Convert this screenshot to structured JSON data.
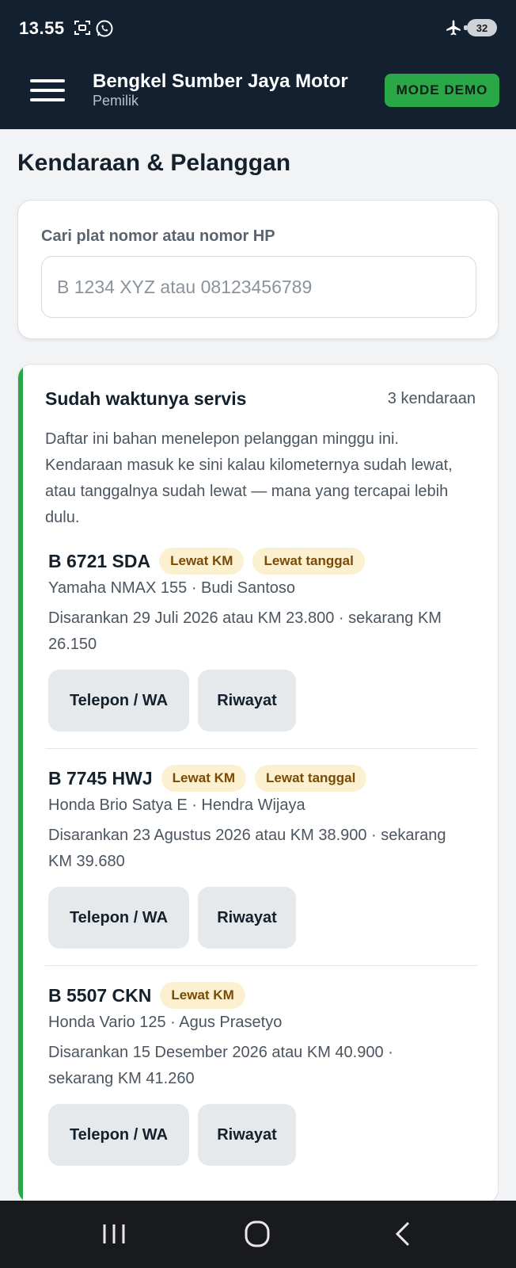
{
  "status_bar": {
    "time": "13.55",
    "battery": "32",
    "icons": [
      "screenshot-icon",
      "whatsapp-icon",
      "airplane-icon",
      "battery-icon"
    ]
  },
  "header": {
    "title": "Bengkel Sumber Jaya Motor",
    "subtitle": "Pemilik",
    "demo_label": "MODE DEMO"
  },
  "page": {
    "title": "Kendaraan & Pelanggan"
  },
  "search": {
    "label": "Cari plat nomor atau nomor HP",
    "placeholder": "B 1234 XYZ atau 08123456789",
    "value": ""
  },
  "service_due": {
    "title": "Sudah waktunya servis",
    "count": "3 kendaraan",
    "description": "Daftar ini bahan menelepon pelanggan minggu ini. Kendaraan masuk ke sini kalau kilometernya sudah lewat, atau tanggalnya sudah lewat — mana yang tercapai lebih dulu.",
    "vehicles": [
      {
        "plate": "B 6721 SDA",
        "badges": [
          "Lewat KM",
          "Lewat tanggal"
        ],
        "model_owner": "Yamaha NMAX 155 · Budi Santoso",
        "note": "Disarankan 29 Juli 2026 atau KM 23.800 · sekarang KM 26.150",
        "call_label": "Telepon / WA",
        "history_label": "Riwayat"
      },
      {
        "plate": "B 7745 HWJ",
        "badges": [
          "Lewat KM",
          "Lewat tanggal"
        ],
        "model_owner": "Honda Brio Satya E · Hendra Wijaya",
        "note": "Disarankan 23 Agustus 2026 atau KM 38.900 · sekarang KM 39.680",
        "call_label": "Telepon / WA",
        "history_label": "Riwayat"
      },
      {
        "plate": "B 5507 CKN",
        "badges": [
          "Lewat KM"
        ],
        "model_owner": "Honda Vario 125 · Agus Prasetyo",
        "note": "Disarankan 15 Desember 2026 atau KM 40.900 · sekarang KM 41.260",
        "call_label": "Telepon / WA",
        "history_label": "Riwayat"
      }
    ]
  },
  "colors": {
    "header_bg": "#132030",
    "accent_green": "#2aa847",
    "badge_bg": "#fbf0cf",
    "badge_text": "#7a4a06",
    "page_bg": "#f1f3f5"
  },
  "nav_bar": {
    "icons": [
      "recent-apps-icon",
      "home-icon",
      "back-icon"
    ]
  }
}
